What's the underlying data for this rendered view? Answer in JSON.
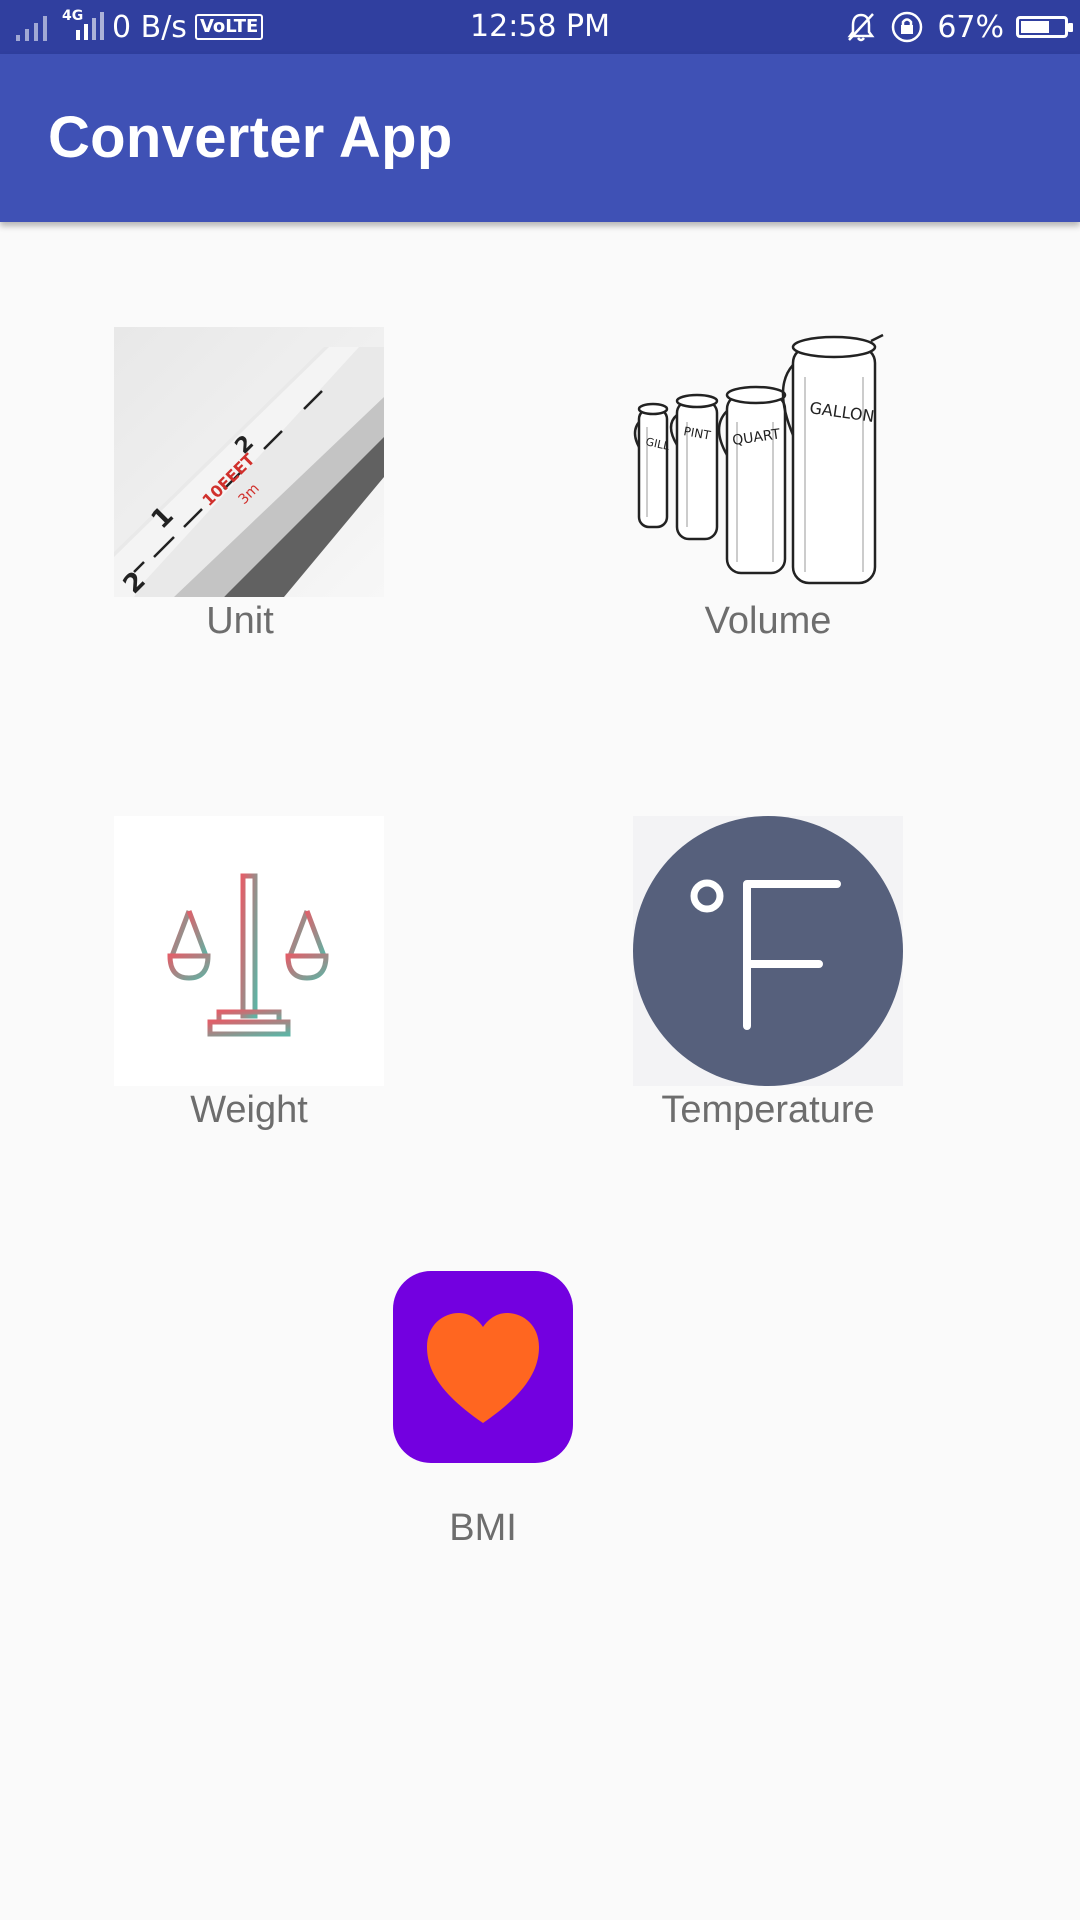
{
  "status_bar": {
    "network_speed": "0 B/s",
    "volte": "VoLTE",
    "network_type": "4G",
    "time": "12:58 PM",
    "battery_percent": "67%",
    "battery_level": 0.67
  },
  "app_bar": {
    "title": "Converter App",
    "color": "#3f51b5"
  },
  "tiles": [
    {
      "label": "Unit",
      "icon": "tape-measure-image",
      "text": [
        "10FEET",
        "3m"
      ]
    },
    {
      "label": "Volume",
      "icon": "measuring-jugs-image",
      "text": [
        "GALLON",
        "QUART",
        "PINT",
        "GILL"
      ]
    },
    {
      "label": "Weight",
      "icon": "balance-scale-icon"
    },
    {
      "label": "Temperature",
      "icon": "fahrenheit-icon",
      "symbol": "°F",
      "color": "#56607c"
    },
    {
      "label": "BMI",
      "icon": "heart-icon",
      "colors": {
        "background": "#7300e0",
        "heart": "#ff6620"
      }
    }
  ]
}
